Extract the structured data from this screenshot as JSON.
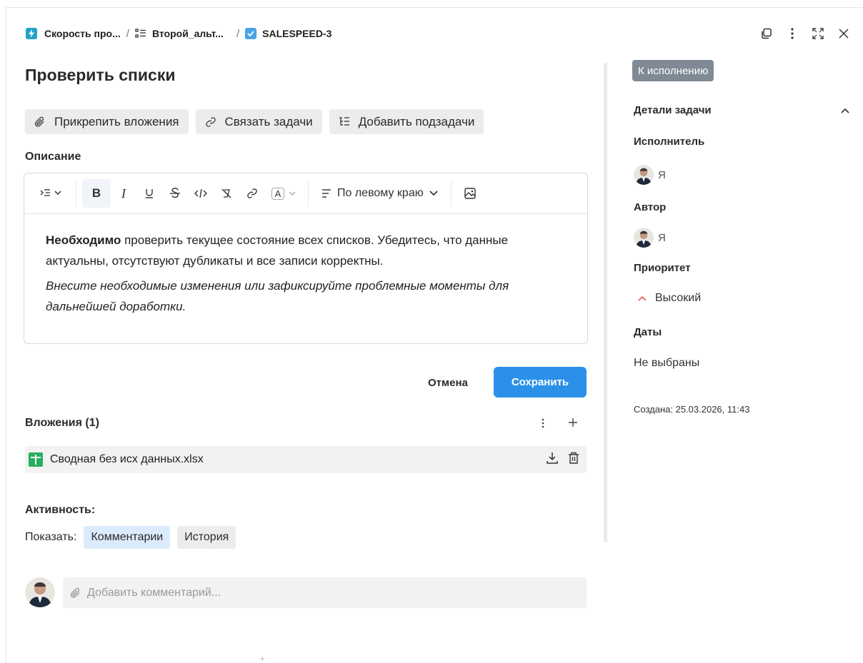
{
  "breadcrumb": {
    "project": "Скорость про...",
    "list": "Второй_альт...",
    "task_key": "SALESPEED-3",
    "separator": "/"
  },
  "task": {
    "title": "Проверить списки"
  },
  "actions": {
    "attach": "Прикрепить вложения",
    "link": "Связать задачи",
    "subtasks": "Добавить подзадачи"
  },
  "description": {
    "label": "Описание",
    "toolbar": {
      "bold": "B",
      "italic": "I",
      "font_color": "A",
      "align": "По левому краю"
    },
    "paragraph1_bold": "Необходимо",
    "paragraph1_rest": " проверить текущее состояние всех списков. Убедитесь, что данные актуальны, отсутствуют дубликаты и все записи корректны.",
    "paragraph2": "Внесите необходимые изменения или зафиксируйте проблемные моменты для дальнейшей доработки."
  },
  "form": {
    "cancel": "Отмена",
    "save": "Сохранить"
  },
  "attachments": {
    "title": "Вложения (1)",
    "files": [
      {
        "name": "Сводная без исх данных.xlsx",
        "icon": "xlsx-file-icon"
      }
    ]
  },
  "activity": {
    "title": "Активность:",
    "show_label": "Показать:",
    "tabs": [
      "Комментарии",
      "История"
    ],
    "active_tab": "Комментарии",
    "comment_placeholder": "Добавить комментарий..."
  },
  "sidebar": {
    "status": "К исполнению",
    "details_title": "Детали задачи",
    "assignee_label": "Исполнитель",
    "assignee": "Я",
    "author_label": "Автор",
    "author": "Я",
    "priority_label": "Приоритет",
    "priority": "Высокий",
    "dates_label": "Даты",
    "dates_value": "Не выбраны",
    "created": "Создана: 25.03.2026, 11:43"
  },
  "colors": {
    "accent": "#2b91e8",
    "status_badge": "#7f8a94",
    "priority_high": "#e05a5a",
    "xlsx": "#27ae60"
  }
}
